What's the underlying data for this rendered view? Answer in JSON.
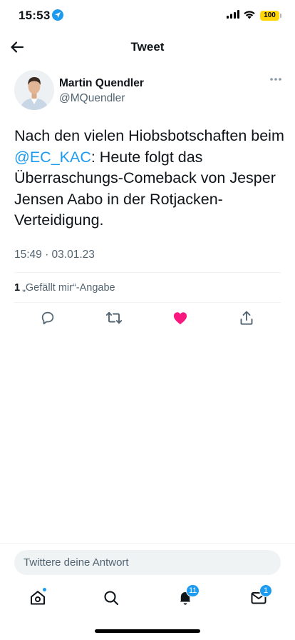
{
  "status_bar": {
    "time": "15:53",
    "battery": "100",
    "battery_color": "#ffd60a"
  },
  "header": {
    "title": "Tweet",
    "back_icon": "arrow-left-icon"
  },
  "tweet": {
    "author": {
      "display_name": "Martin Quendler",
      "handle": "@MQuendler"
    },
    "text_before": "Nach den vielen Hiobsbotschaften beim ",
    "mention": "@EC_KAC",
    "text_after": ": Heute folgt das Überraschungs-Comeback von Jesper Jensen Aabo in der Rotjacken-Verteidigung.",
    "timestamp": "15:49 · 03.01.23",
    "likes": {
      "count": "1",
      "label": "„Gefällt mir“-Angabe"
    },
    "liked": true,
    "accent_color": "#1d9bf0",
    "like_color": "#f91880"
  },
  "actions": [
    {
      "name": "reply",
      "icon": "comment-icon"
    },
    {
      "name": "retweet",
      "icon": "retweet-icon"
    },
    {
      "name": "like",
      "icon": "heart-icon"
    },
    {
      "name": "share",
      "icon": "share-icon"
    }
  ],
  "reply_bar": {
    "placeholder": "Twittere deine Antwort"
  },
  "tab_bar": {
    "notifications_badge": "11",
    "messages_badge": "1"
  }
}
